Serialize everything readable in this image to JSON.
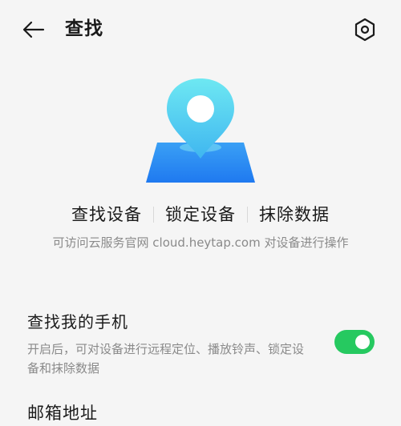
{
  "header": {
    "back_icon": "arrow-left-icon",
    "title": "查找",
    "settings_icon": "hexagon-gear-icon"
  },
  "illustration": {
    "icon": "location-pin-on-map-icon",
    "colors": {
      "pin_top": "#6ee8f2",
      "pin_bottom": "#3fb6f0",
      "map_top": "#3aa0f5",
      "map_bottom": "#1f79f0"
    }
  },
  "actions": [
    {
      "label": "查找设备"
    },
    {
      "label": "锁定设备"
    },
    {
      "label": "抹除数据"
    }
  ],
  "hint": "可访问云服务官网 cloud.heytap.com 对设备进行操作",
  "find_my_phone": {
    "title": "查找我的手机",
    "description": "开启后，可对设备进行远程定位、播放铃声、锁定设备和抹除数据",
    "toggle_on": true,
    "toggle_color": "#26c960"
  },
  "email_section": {
    "title": "邮箱地址"
  }
}
